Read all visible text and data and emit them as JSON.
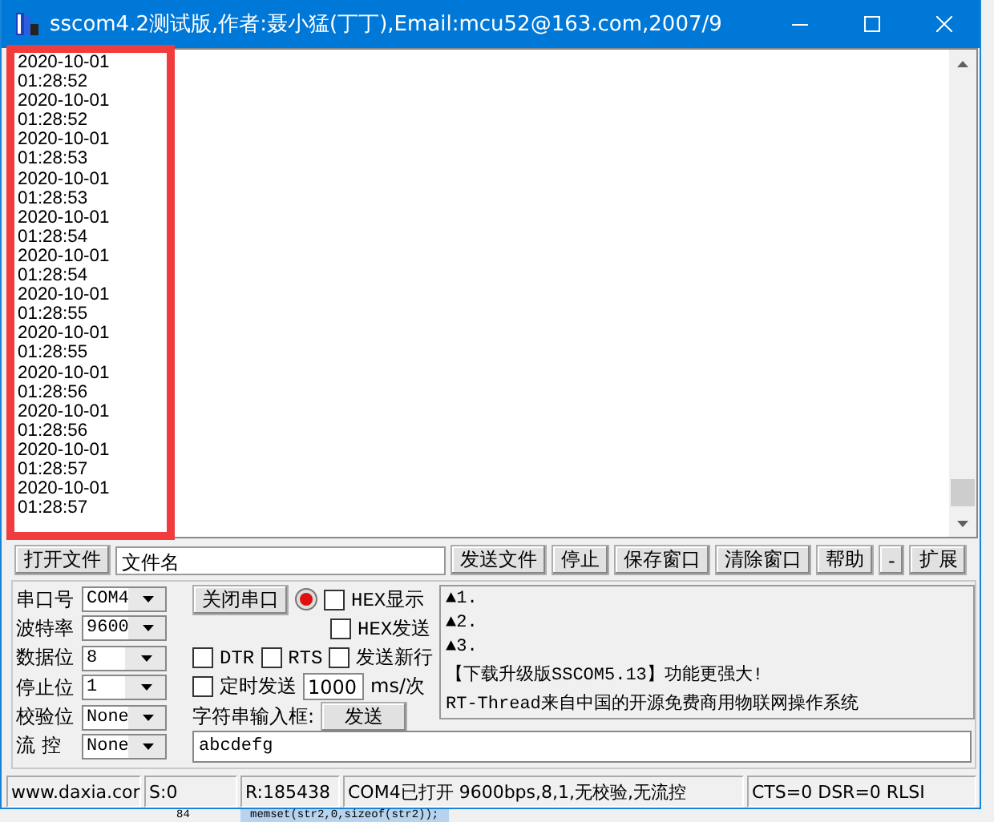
{
  "window": {
    "title": "sscom4.2测试版,作者:聂小猛(丁丁),Email:mcu52@163.com,2007/9"
  },
  "receive": {
    "lines": [
      "2020-10-01",
      "01:28:52",
      "2020-10-01",
      "01:28:52",
      "2020-10-01",
      "01:28:53",
      "2020-10-01",
      "01:28:53",
      "2020-10-01",
      "01:28:54",
      "2020-10-01",
      "01:28:54",
      "2020-10-01",
      "01:28:55",
      "2020-10-01",
      "01:28:55",
      "2020-10-01",
      "01:28:56",
      "2020-10-01",
      "01:28:56",
      "2020-10-01",
      "01:28:57",
      "2020-10-01",
      "01:28:57"
    ]
  },
  "file_bar": {
    "open_button": "打开文件",
    "file_name": "文件名",
    "buttons": [
      "发送文件",
      "停止",
      "保存窗口",
      "清除窗口",
      "帮助",
      "-",
      "扩展"
    ]
  },
  "settings": [
    {
      "label": "串口号",
      "value": "COM4"
    },
    {
      "label": "波特率",
      "value": "9600"
    },
    {
      "label": "数据位",
      "value": "8"
    },
    {
      "label": "停止位",
      "value": "1"
    },
    {
      "label": "校验位",
      "value": "None"
    },
    {
      "label": "流 控",
      "value": "None"
    }
  ],
  "port_button": "关闭串口",
  "port_open": true,
  "hex_display": {
    "label": "HEX显示",
    "checked": false
  },
  "hex_send": {
    "label": "HEX发送",
    "checked": false
  },
  "dtr": {
    "label": "DTR",
    "checked": false
  },
  "rts": {
    "label": "RTS",
    "checked": false
  },
  "send_newline": {
    "label": "发送新行",
    "checked": false
  },
  "timed_send": {
    "label": "定时发送",
    "checked": false,
    "interval": "1000",
    "unit": "ms/次"
  },
  "string_input_label": "字符串输入框:",
  "send_button": "发送",
  "info_lines": [
    "▲1.",
    "▲2.",
    "▲3.",
    "【下载升级版SSCOM5.13】功能更强大!",
    "RT-Thread来自中国的开源免费商用物联网操作系统"
  ],
  "send_text": "abcdefg",
  "status_bar": [
    "www.daxia.cor",
    "S:0",
    "R:185438",
    "COM4已打开  9600bps,8,1,无校验,无流控",
    "CTS=0 DSR=0 RLSI"
  ],
  "background": {
    "line_number": "84",
    "code": "memset(str2,0,sizeof(str2));"
  }
}
